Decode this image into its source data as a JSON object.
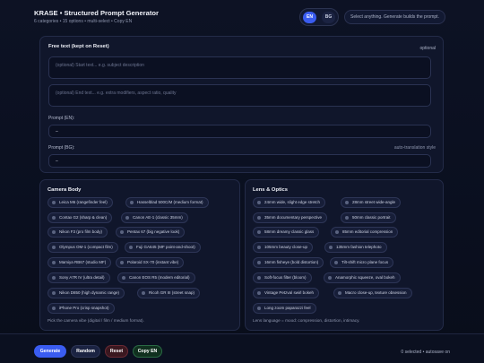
{
  "header": {
    "title": "KRASE • Structured Prompt Generator",
    "subtitle": "6 categories • 15 options • multi-select • Copy EN",
    "lang": [
      "EN",
      "BG"
    ],
    "hint": "Select anything. Generate builds the prompt."
  },
  "freetext": {
    "title": "Free text (kept on Reset)",
    "optional": "optional",
    "start_placeholder": "(optional) Start text... e.g. subject description",
    "end_placeholder": "(optional) End text... e.g. extra modifiers, aspect ratio, quality",
    "prompt_en_label": "Prompt (EN):",
    "prompt_en_value": "–",
    "prompt_bg_label": "Prompt (BG):",
    "prompt_bg_note": "auto-translation style",
    "prompt_bg_value": "–"
  },
  "camera": {
    "title": "Camera Body",
    "options": [
      "Leica M6 (rangefinder feel)",
      "Hasselblad 500C/M (medium format)",
      "Contax G2 (sharp & clean)",
      "Canon AE-1 (classic 35mm)",
      "Nikon F3 (pro film body)",
      "Pentax 67 (big negative look)",
      "Olympus OM-1 (compact film)",
      "Fuji GA645 (MF point-and-shoot)",
      "Mamiya RB67 (studio MF)",
      "Polaroid SX-70 (instant vibe)",
      "Sony A7R IV (ultra detail)",
      "Canon EOS R5 (modern editorial)",
      "Nikon D850 (high dynamic range)",
      "Ricoh GR III (street snap)",
      "iPhone Pro (crisp snapshot)"
    ],
    "note": "Pick the camera vibe (digital / film / medium format)."
  },
  "lens": {
    "title": "Lens & Optics",
    "options": [
      "24mm wide, slight edge stretch",
      "28mm street wide-angle",
      "35mm documentary perspective",
      "50mm classic portrait",
      "58mm dreamy classic glass",
      "85mm editorial compression",
      "105mm beauty close-up",
      "135mm fashion telephoto",
      "16mm fisheye (bold distortion)",
      "Tilt-shift micro plane focus",
      "Soft-focus filter (bloom)",
      "Anamorphic squeeze, oval bokeh",
      "Vintage Petzval swirl bokeh",
      "Macro close-up, texture obsession",
      "Long zoom paparazzi feel"
    ],
    "note": "Lens language = mood: compression, distortion, intimacy."
  },
  "footer": {
    "generate": "Generate",
    "random": "Random",
    "reset": "Reset",
    "copy": "Copy EN",
    "status": "0 selected • autosave on"
  },
  "colors": {
    "accent": "#3a5cf0",
    "background": "#0d1224",
    "card": "#10162b",
    "reset": "#3a1820",
    "copy": "#10301f"
  }
}
